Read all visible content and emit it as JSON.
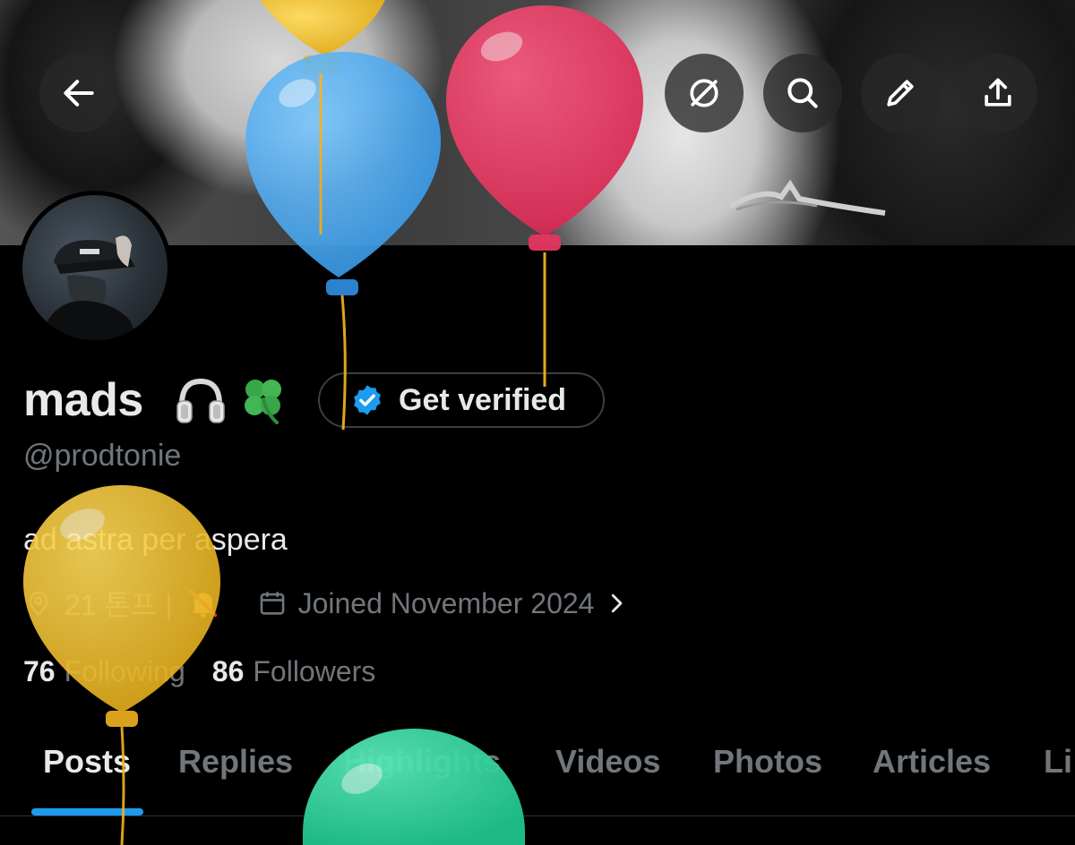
{
  "header": {
    "back_icon": "arrow-left-icon",
    "actions": [
      "translate-icon",
      "search-icon",
      "edit-pencil-icon",
      "share-upload-icon"
    ]
  },
  "profile": {
    "display_name": "mads",
    "name_emojis": [
      "headphones",
      "four-leaf-clover"
    ],
    "verify_button_label": "Get verified",
    "handle": "@prodtonie",
    "bio": "ad astra per aspera",
    "location": "21 톤프 |",
    "joined": "Joined November 2024",
    "following_count": "76",
    "following_label": "Following",
    "followers_count": "86",
    "followers_label": "Followers"
  },
  "tabs": [
    {
      "label": "Posts",
      "active": true
    },
    {
      "label": "Replies",
      "active": false
    },
    {
      "label": "Highlights",
      "active": false
    },
    {
      "label": "Videos",
      "active": false
    },
    {
      "label": "Photos",
      "active": false
    },
    {
      "label": "Articles",
      "active": false
    },
    {
      "label": "Li",
      "active": false
    }
  ],
  "colors": {
    "background": "#000000",
    "text_primary": "#e7e9ea",
    "text_secondary": "#71767b",
    "accent": "#1d9bf0",
    "balloon_yellow": "#f3c12c",
    "balloon_blue": "#4aa9ee",
    "balloon_red": "#e5355f",
    "balloon_green": "#31d8a0"
  }
}
